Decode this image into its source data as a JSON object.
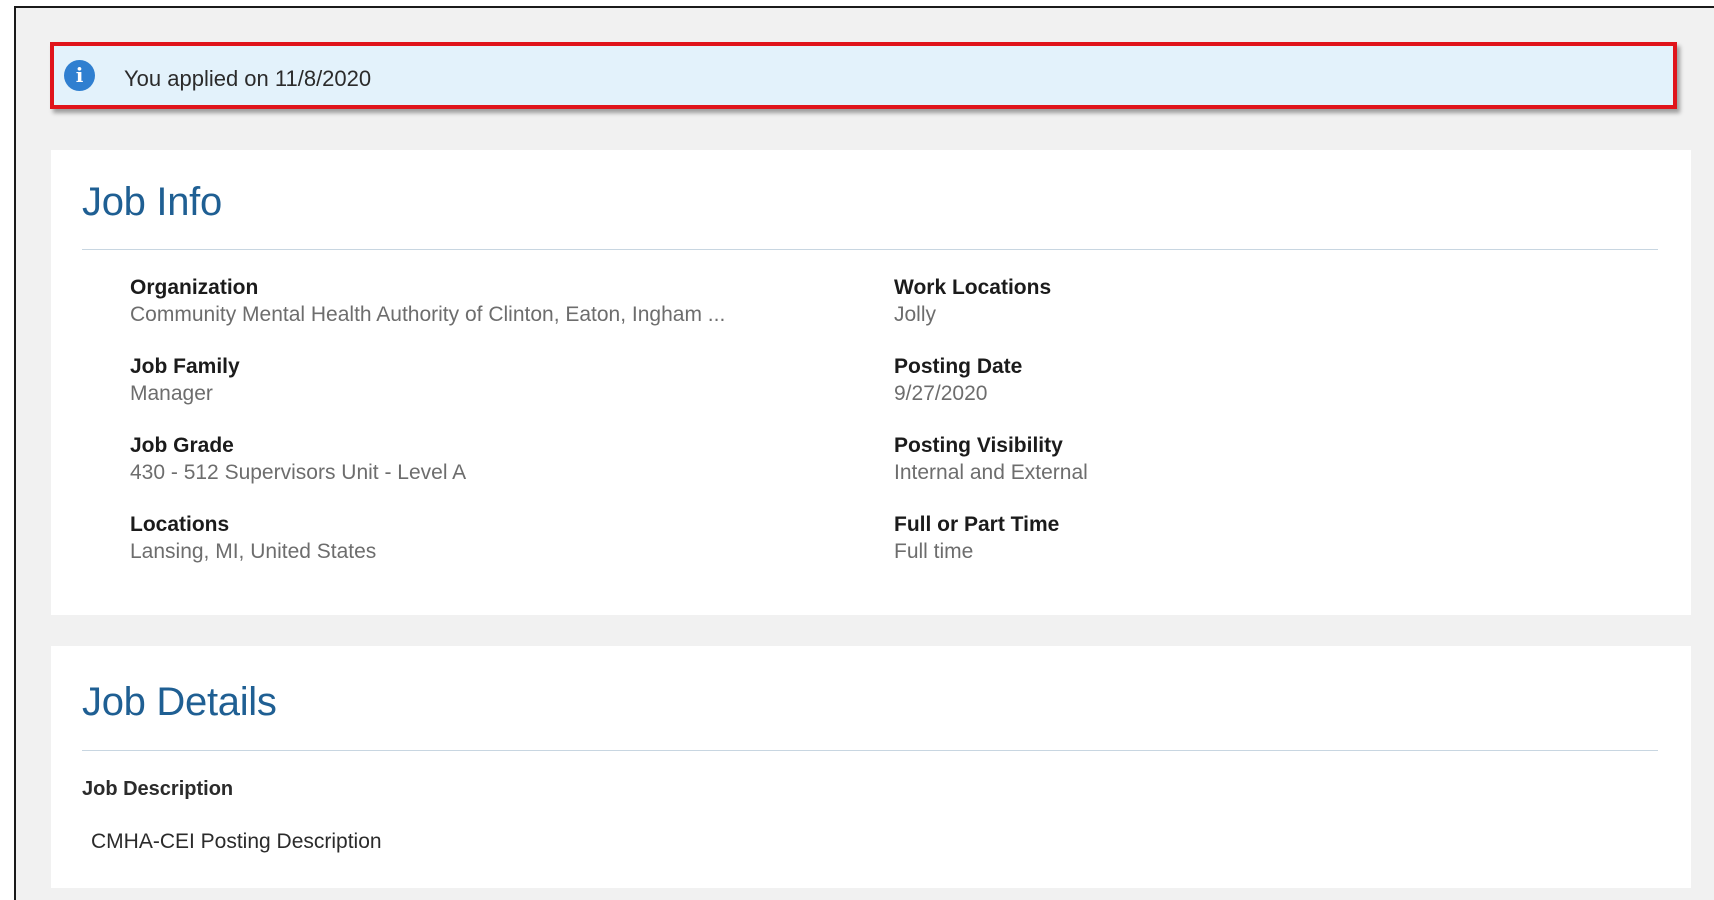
{
  "notice": {
    "icon": "info-icon",
    "text": "You applied on 11/8/2020"
  },
  "job_info": {
    "title": "Job Info",
    "fields": [
      {
        "label": "Organization",
        "value": "Community Mental Health Authority of Clinton, Eaton, Ingham ..."
      },
      {
        "label": "Work Locations",
        "value": "Jolly"
      },
      {
        "label": "Job Family",
        "value": "Manager"
      },
      {
        "label": "Posting Date",
        "value": "9/27/2020"
      },
      {
        "label": "Job Grade",
        "value": "430 - 512 Supervisors Unit - Level A"
      },
      {
        "label": "Posting Visibility",
        "value": "Internal and External"
      },
      {
        "label": "Locations",
        "value": "Lansing, MI, United States"
      },
      {
        "label": "Full or Part Time",
        "value": "Full time"
      }
    ]
  },
  "job_details": {
    "title": "Job Details",
    "description_label": "Job Description",
    "description_text": "CMHA-CEI Posting Description"
  },
  "colors": {
    "notice_border": "#e0141b",
    "notice_background": "#e3f2fb",
    "info_icon": "#2f7fd0",
    "section_title": "#1f5f93"
  }
}
